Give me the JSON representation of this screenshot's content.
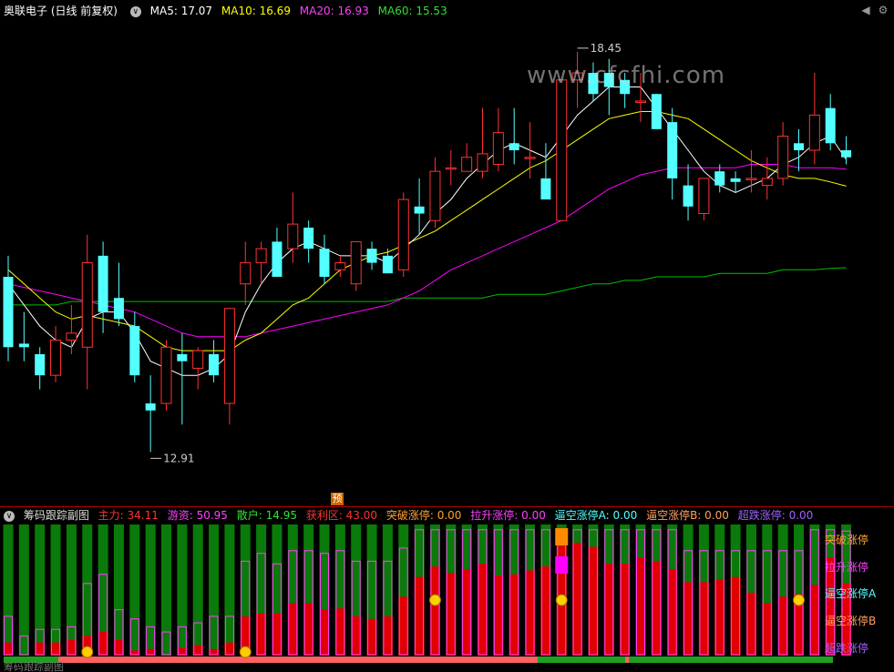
{
  "header": {
    "title": "奥联电子 (日线 前复权)",
    "ma5": "MA5: 17.07",
    "ma10": "MA10: 16.69",
    "ma20": "MA20: 16.93",
    "ma60": "MA60: 15.53"
  },
  "watermark": "www.cfcfhi.com",
  "price_labels": {
    "high": "18.45",
    "low": "12.91"
  },
  "pre_marker": "预",
  "indicator": {
    "title": "筹码跟踪副图",
    "main": "主力: 34.11",
    "retail_fund": "游资: 50.95",
    "retail": "散户: 14.95",
    "profit": "获利区: 43.00",
    "breakout": "突破涨停: 0.00",
    "pullup": "拉升涨停: 0.00",
    "short_a": "逼空涨停A: 0.00",
    "short_b": "逼空涨停B: 0.00",
    "oversold": "超跌涨停: 0.00"
  },
  "legend_right": [
    "突破涨停",
    "拉升涨停",
    "逼空涨停A",
    "逼空涨停B",
    "超跌涨停"
  ],
  "footer_text": "筹码跟踪副图",
  "colors": {
    "up": "#ff3232",
    "down": "#54ffff",
    "ma5": "#ffffff",
    "ma10": "#ffff00",
    "ma20": "#ff00ff",
    "ma60": "#00c000",
    "main_bar": "#e00000",
    "other_bar": "#0a7a0a"
  },
  "chart_data": {
    "type": "candlestick",
    "price_range": [
      12.5,
      19.0
    ],
    "candles": [
      {
        "o": 15.4,
        "h": 15.7,
        "l": 14.2,
        "c": 14.4
      },
      {
        "o": 14.45,
        "h": 14.9,
        "l": 14.2,
        "c": 14.4
      },
      {
        "o": 14.3,
        "h": 14.4,
        "l": 13.8,
        "c": 14.0
      },
      {
        "o": 14.0,
        "h": 14.7,
        "l": 13.9,
        "c": 14.5
      },
      {
        "o": 14.5,
        "h": 15.0,
        "l": 14.3,
        "c": 14.6
      },
      {
        "o": 14.4,
        "h": 16.0,
        "l": 13.8,
        "c": 15.6
      },
      {
        "o": 15.7,
        "h": 15.9,
        "l": 14.6,
        "c": 14.9
      },
      {
        "o": 15.1,
        "h": 15.6,
        "l": 14.7,
        "c": 14.8
      },
      {
        "o": 14.7,
        "h": 14.9,
        "l": 13.9,
        "c": 14.0
      },
      {
        "o": 13.6,
        "h": 14.0,
        "l": 12.91,
        "c": 13.5
      },
      {
        "o": 13.6,
        "h": 14.5,
        "l": 13.5,
        "c": 14.4
      },
      {
        "o": 14.3,
        "h": 14.6,
        "l": 13.3,
        "c": 14.2
      },
      {
        "o": 14.1,
        "h": 14.4,
        "l": 13.8,
        "c": 14.35
      },
      {
        "o": 14.3,
        "h": 14.5,
        "l": 13.9,
        "c": 14.0
      },
      {
        "o": 13.6,
        "h": 14.9,
        "l": 13.3,
        "c": 14.95
      },
      {
        "o": 15.3,
        "h": 15.9,
        "l": 15.0,
        "c": 15.6
      },
      {
        "o": 15.6,
        "h": 15.9,
        "l": 15.3,
        "c": 15.8
      },
      {
        "o": 15.9,
        "h": 16.1,
        "l": 15.4,
        "c": 15.4
      },
      {
        "o": 15.8,
        "h": 16.6,
        "l": 15.6,
        "c": 16.15
      },
      {
        "o": 16.1,
        "h": 16.2,
        "l": 15.6,
        "c": 15.8
      },
      {
        "o": 15.8,
        "h": 16.0,
        "l": 15.3,
        "c": 15.4
      },
      {
        "o": 15.5,
        "h": 15.7,
        "l": 15.4,
        "c": 15.6
      },
      {
        "o": 15.3,
        "h": 15.9,
        "l": 15.2,
        "c": 15.9
      },
      {
        "o": 15.8,
        "h": 15.9,
        "l": 15.5,
        "c": 15.6
      },
      {
        "o": 15.7,
        "h": 15.8,
        "l": 15.5,
        "c": 15.45
      },
      {
        "o": 15.5,
        "h": 16.6,
        "l": 15.4,
        "c": 16.5
      },
      {
        "o": 16.4,
        "h": 16.8,
        "l": 16.0,
        "c": 16.3
      },
      {
        "o": 16.2,
        "h": 17.1,
        "l": 16.1,
        "c": 16.9
      },
      {
        "o": 16.95,
        "h": 17.2,
        "l": 16.7,
        "c": 16.95
      },
      {
        "o": 16.9,
        "h": 17.3,
        "l": 16.9,
        "c": 17.1
      },
      {
        "o": 16.9,
        "h": 17.8,
        "l": 16.8,
        "c": 17.15
      },
      {
        "o": 17.0,
        "h": 17.8,
        "l": 16.9,
        "c": 17.45
      },
      {
        "o": 17.3,
        "h": 17.8,
        "l": 17.0,
        "c": 17.2
      },
      {
        "o": 17.1,
        "h": 17.6,
        "l": 16.8,
        "c": 17.1
      },
      {
        "o": 16.8,
        "h": 17.3,
        "l": 16.5,
        "c": 16.5
      },
      {
        "o": 16.2,
        "h": 18.2,
        "l": 16.2,
        "c": 18.2
      },
      {
        "o": 18.2,
        "h": 18.6,
        "l": 17.8,
        "c": 18.3
      },
      {
        "o": 18.3,
        "h": 18.45,
        "l": 17.9,
        "c": 18.0
      },
      {
        "o": 18.3,
        "h": 18.5,
        "l": 17.7,
        "c": 18.1
      },
      {
        "o": 18.2,
        "h": 18.3,
        "l": 17.8,
        "c": 18.0
      },
      {
        "o": 17.9,
        "h": 18.3,
        "l": 17.6,
        "c": 17.9
      },
      {
        "o": 18.0,
        "h": 18.0,
        "l": 17.5,
        "c": 17.5
      },
      {
        "o": 17.6,
        "h": 17.8,
        "l": 16.5,
        "c": 16.8
      },
      {
        "o": 16.7,
        "h": 17.0,
        "l": 16.2,
        "c": 16.4
      },
      {
        "o": 16.3,
        "h": 16.8,
        "l": 16.2,
        "c": 16.8
      },
      {
        "o": 16.9,
        "h": 17.0,
        "l": 16.6,
        "c": 16.7
      },
      {
        "o": 16.8,
        "h": 16.9,
        "l": 16.6,
        "c": 16.75
      },
      {
        "o": 16.8,
        "h": 17.2,
        "l": 16.6,
        "c": 16.8
      },
      {
        "o": 16.7,
        "h": 17.1,
        "l": 16.5,
        "c": 16.8
      },
      {
        "o": 16.8,
        "h": 17.6,
        "l": 16.7,
        "c": 17.4
      },
      {
        "o": 17.3,
        "h": 17.5,
        "l": 16.9,
        "c": 17.2
      },
      {
        "o": 17.2,
        "h": 18.3,
        "l": 17.0,
        "c": 17.7
      },
      {
        "o": 17.8,
        "h": 18.0,
        "l": 17.2,
        "c": 17.3
      },
      {
        "o": 17.2,
        "h": 17.4,
        "l": 17.0,
        "c": 17.1
      }
    ],
    "ma5": [
      15.3,
      15.0,
      14.7,
      14.5,
      14.4,
      14.8,
      14.9,
      14.9,
      14.6,
      14.2,
      14.1,
      14.0,
      14.0,
      14.1,
      14.3,
      14.9,
      15.3,
      15.6,
      15.8,
      15.9,
      15.8,
      15.7,
      15.7,
      15.7,
      15.6,
      15.8,
      16.0,
      16.3,
      16.5,
      16.8,
      17.0,
      17.2,
      17.3,
      17.2,
      17.1,
      17.4,
      17.7,
      17.9,
      18.1,
      18.1,
      18.1,
      17.8,
      17.5,
      17.2,
      16.9,
      16.7,
      16.6,
      16.7,
      16.8,
      17.0,
      17.1,
      17.3,
      17.4,
      17.07
    ],
    "ma10": [
      15.5,
      15.3,
      15.1,
      14.9,
      14.8,
      14.85,
      14.8,
      14.75,
      14.7,
      14.55,
      14.4,
      14.35,
      14.35,
      14.35,
      14.35,
      14.5,
      14.6,
      14.8,
      15.0,
      15.1,
      15.3,
      15.5,
      15.6,
      15.7,
      15.75,
      15.85,
      15.95,
      16.05,
      16.2,
      16.35,
      16.5,
      16.65,
      16.8,
      16.95,
      17.05,
      17.2,
      17.35,
      17.5,
      17.65,
      17.7,
      17.75,
      17.75,
      17.7,
      17.65,
      17.5,
      17.35,
      17.2,
      17.05,
      16.95,
      16.85,
      16.8,
      16.8,
      16.75,
      16.69
    ],
    "ma20": [
      15.3,
      15.25,
      15.2,
      15.15,
      15.1,
      15.05,
      15.0,
      14.95,
      14.9,
      14.8,
      14.7,
      14.6,
      14.55,
      14.55,
      14.55,
      14.55,
      14.6,
      14.65,
      14.7,
      14.75,
      14.8,
      14.85,
      14.9,
      14.95,
      15.0,
      15.1,
      15.2,
      15.35,
      15.5,
      15.6,
      15.7,
      15.8,
      15.9,
      16.0,
      16.1,
      16.2,
      16.35,
      16.5,
      16.65,
      16.75,
      16.85,
      16.9,
      16.95,
      16.95,
      16.95,
      16.95,
      16.95,
      17.0,
      17.0,
      17.0,
      16.95,
      16.95,
      16.95,
      16.93
    ],
    "ma60": [
      15.0,
      15.0,
      15.0,
      15.0,
      15.05,
      15.05,
      15.05,
      15.05,
      15.05,
      15.05,
      15.05,
      15.05,
      15.05,
      15.05,
      15.05,
      15.05,
      15.05,
      15.05,
      15.05,
      15.05,
      15.05,
      15.05,
      15.05,
      15.05,
      15.05,
      15.1,
      15.1,
      15.1,
      15.1,
      15.1,
      15.1,
      15.15,
      15.15,
      15.15,
      15.15,
      15.2,
      15.25,
      15.3,
      15.3,
      15.35,
      15.35,
      15.4,
      15.4,
      15.4,
      15.4,
      15.45,
      15.45,
      15.45,
      15.45,
      15.5,
      15.5,
      15.5,
      15.52,
      15.53
    ],
    "main_force": [
      0.1,
      0.0,
      0.1,
      0.1,
      0.12,
      0.15,
      0.18,
      0.12,
      0.04,
      0.05,
      0.0,
      0.06,
      0.08,
      0.05,
      0.1,
      0.3,
      0.32,
      0.32,
      0.4,
      0.4,
      0.35,
      0.36,
      0.3,
      0.28,
      0.3,
      0.45,
      0.6,
      0.68,
      0.63,
      0.66,
      0.7,
      0.61,
      0.62,
      0.65,
      0.68,
      0.88,
      0.86,
      0.83,
      0.7,
      0.7,
      0.75,
      0.72,
      0.66,
      0.56,
      0.56,
      0.58,
      0.6,
      0.48,
      0.4,
      0.45,
      0.47,
      0.54,
      0.75,
      0.55
    ],
    "profit_line": [
      0.3,
      0.15,
      0.2,
      0.2,
      0.22,
      0.55,
      0.62,
      0.35,
      0.28,
      0.22,
      0.18,
      0.22,
      0.25,
      0.3,
      0.3,
      0.72,
      0.78,
      0.7,
      0.8,
      0.8,
      0.78,
      0.8,
      0.72,
      0.72,
      0.72,
      0.82,
      0.96,
      0.96,
      0.96,
      0.96,
      0.96,
      0.96,
      0.96,
      0.96,
      0.96,
      0.96,
      0.96,
      0.96,
      0.96,
      0.96,
      0.96,
      0.96,
      0.96,
      0.8,
      0.8,
      0.8,
      0.8,
      0.8,
      0.8,
      0.8,
      0.8,
      0.96,
      0.96,
      0.95
    ]
  }
}
